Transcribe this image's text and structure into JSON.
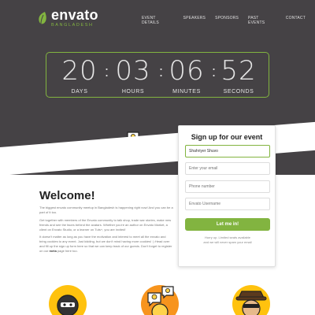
{
  "brand": {
    "name": "envato",
    "sub": "BANGLADESH",
    "accent": "#82b440",
    "dark_bg": "#454245"
  },
  "nav": [
    "EVENT DETAILS",
    "SPEAKERS",
    "SPONSORS",
    "PAST EVENTS",
    "CONTACT"
  ],
  "countdown": [
    {
      "value": "20",
      "label": "DAYS"
    },
    {
      "value": "03",
      "label": "HOURS"
    },
    {
      "value": "06",
      "label": "MINUTES"
    },
    {
      "value": "52",
      "label": "SECONDS"
    }
  ],
  "signup": {
    "title": "Sign up for our event",
    "name_value": "Shahriyer Shuvo",
    "email_placeholder": "Enter your email",
    "phone_placeholder": "Phone number",
    "username_placeholder": "Envato Username",
    "button": "Let me in!",
    "note_line1": "Hurry up. Limited seats available",
    "note_line2": "and we will never spam your email"
  },
  "welcome": {
    "heading": "Welcome!",
    "p1": "The biggest envato community meetup in Bangladesh is happening right now! And you can be a part of it too.",
    "p2": "Get together with members of the Envato community to talk shop, trade war stories, make new friends and see the faces behind the avatars. Whether you're an author on Envato Market, a client on Envato Studio, or a learner on Tuts+, you are invited!",
    "p3_a": "It doesn't matter as long as you have the motivation and interest to meet all the envato and bring cookies to any event. Just kidding, but we don't mind having more cookies! :) Head over and fill up the sign up form here so that we can keep track of our guests. Don't forget to register on our ",
    "p3_bold": "meta",
    "p3_b": " page here too."
  }
}
